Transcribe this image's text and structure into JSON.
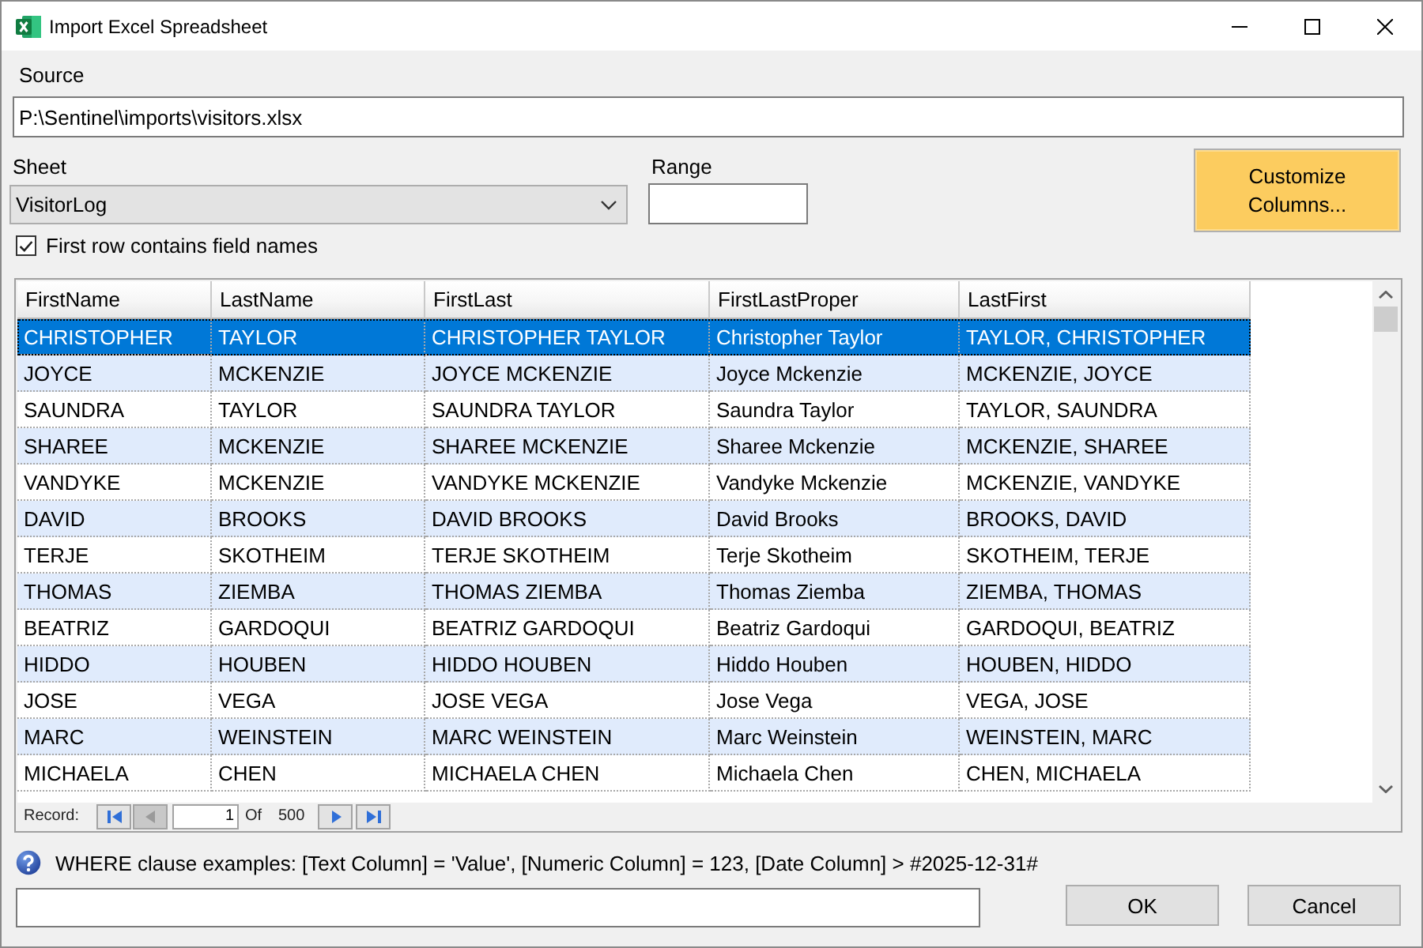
{
  "window": {
    "title": "Import Excel Spreadsheet"
  },
  "source": {
    "label": "Source",
    "value": "P:\\Sentinel\\imports\\visitors.xlsx"
  },
  "sheet": {
    "label": "Sheet",
    "value": "VisitorLog"
  },
  "range": {
    "label": "Range"
  },
  "customize_button": {
    "label": "Customize Columns..."
  },
  "first_row_field_names": {
    "label": "First row contains field names",
    "checked": true
  },
  "table": {
    "columns": [
      "FirstName",
      "LastName",
      "FirstLast",
      "FirstLastProper",
      "LastFirst"
    ],
    "rows": [
      {
        "selected": true,
        "cells": [
          "CHRISTOPHER",
          "TAYLOR",
          "CHRISTOPHER TAYLOR",
          "Christopher Taylor",
          "TAYLOR, CHRISTOPHER"
        ]
      },
      {
        "selected": false,
        "cells": [
          "JOYCE",
          "MCKENZIE",
          "JOYCE MCKENZIE",
          "Joyce Mckenzie",
          "MCKENZIE, JOYCE"
        ]
      },
      {
        "selected": false,
        "cells": [
          "SAUNDRA",
          "TAYLOR",
          "SAUNDRA TAYLOR",
          "Saundra Taylor",
          "TAYLOR, SAUNDRA"
        ]
      },
      {
        "selected": false,
        "cells": [
          "SHAREE",
          "MCKENZIE",
          "SHAREE MCKENZIE",
          "Sharee Mckenzie",
          "MCKENZIE, SHAREE"
        ]
      },
      {
        "selected": false,
        "cells": [
          "VANDYKE",
          "MCKENZIE",
          "VANDYKE MCKENZIE",
          "Vandyke Mckenzie",
          "MCKENZIE, VANDYKE"
        ]
      },
      {
        "selected": false,
        "cells": [
          "DAVID",
          "BROOKS",
          "DAVID BROOKS",
          "David Brooks",
          "BROOKS, DAVID"
        ]
      },
      {
        "selected": false,
        "cells": [
          "TERJE",
          "SKOTHEIM",
          "TERJE SKOTHEIM",
          "Terje Skotheim",
          "SKOTHEIM, TERJE"
        ]
      },
      {
        "selected": false,
        "cells": [
          "THOMAS",
          "ZIEMBA",
          "THOMAS ZIEMBA",
          "Thomas Ziemba",
          "ZIEMBA, THOMAS"
        ]
      },
      {
        "selected": false,
        "cells": [
          "BEATRIZ",
          "GARDOQUI",
          "BEATRIZ GARDOQUI",
          "Beatriz Gardoqui",
          "GARDOQUI, BEATRIZ"
        ]
      },
      {
        "selected": false,
        "cells": [
          "HIDDO",
          "HOUBEN",
          "HIDDO HOUBEN",
          "Hiddo Houben",
          "HOUBEN, HIDDO"
        ]
      },
      {
        "selected": false,
        "cells": [
          "JOSE",
          "VEGA",
          "JOSE VEGA",
          "Jose Vega",
          "VEGA, JOSE"
        ]
      },
      {
        "selected": false,
        "cells": [
          "MARC",
          "WEINSTEIN",
          "MARC WEINSTEIN",
          "Marc Weinstein",
          "WEINSTEIN, MARC"
        ]
      },
      {
        "selected": false,
        "cells": [
          "MICHAELA",
          "CHEN",
          "MICHAELA CHEN",
          "Michaela Chen",
          "CHEN, MICHAELA"
        ]
      }
    ]
  },
  "record_navigator": {
    "label": "Record:",
    "current": "1",
    "of_label": "Of",
    "total": "500",
    "buttons": [
      {
        "kind": "first",
        "disabled": false
      },
      {
        "kind": "previous",
        "disabled": true
      },
      {
        "kind": "next",
        "disabled": false
      },
      {
        "kind": "last",
        "disabled": false
      }
    ]
  },
  "where_help": {
    "text": "WHERE clause examples: [Text Column] = 'Value', [Numeric Column] = 123, [Date Column] > #2025-12-31#"
  },
  "buttons": [
    {
      "label": "OK"
    },
    {
      "label": "Cancel"
    }
  ]
}
